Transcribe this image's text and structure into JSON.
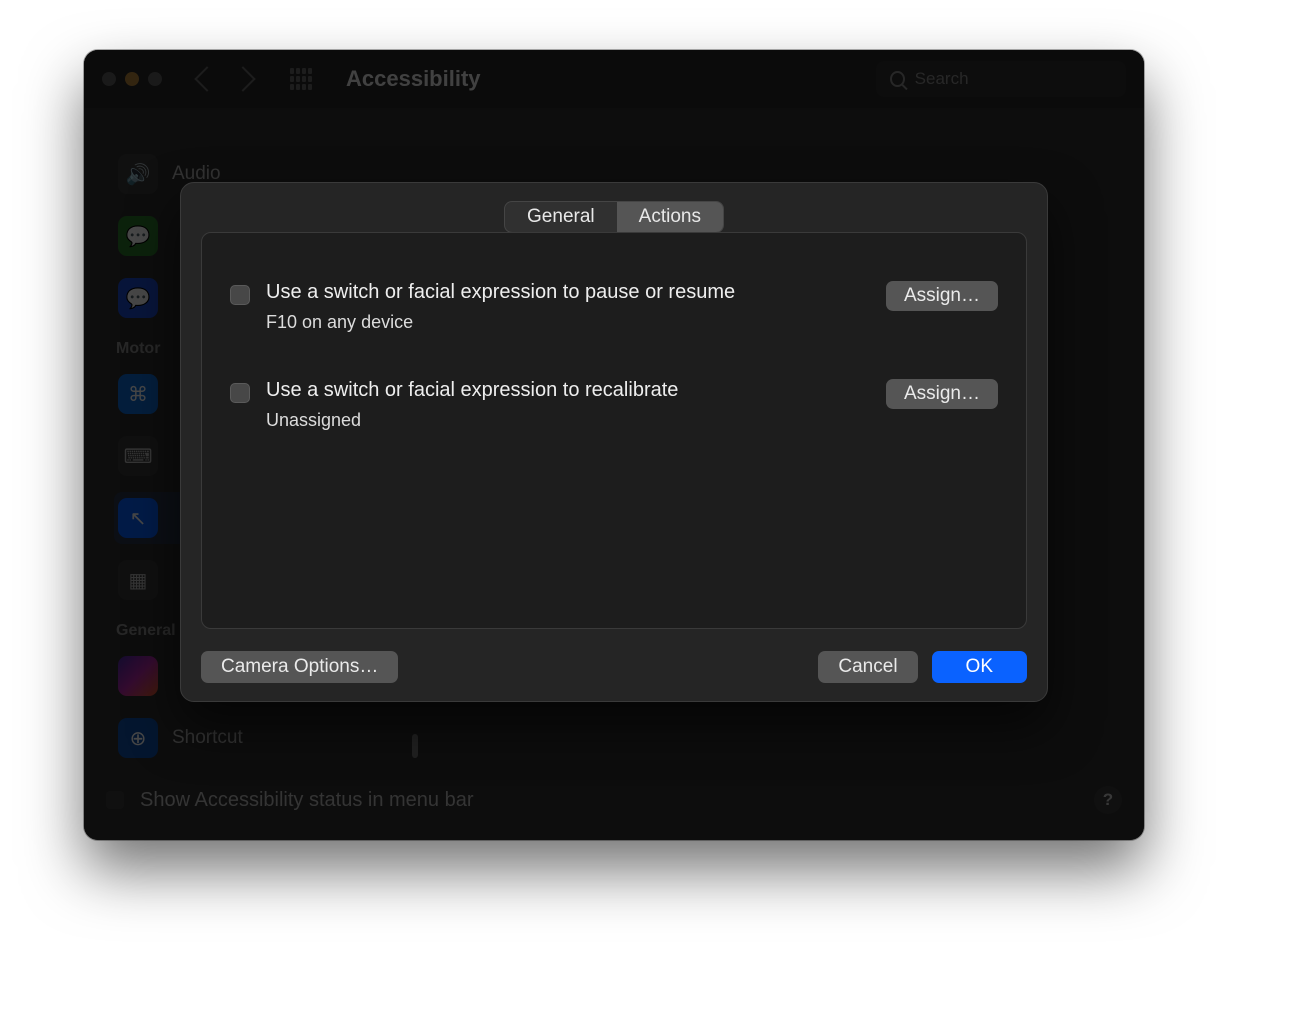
{
  "window": {
    "title": "Accessibility",
    "search_placeholder": "Search"
  },
  "sidebar": {
    "items": [
      {
        "label": "Audio"
      },
      {
        "label": ""
      },
      {
        "label": ""
      },
      {
        "section": "Motor"
      },
      {
        "label": ""
      },
      {
        "label": ""
      },
      {
        "label": ""
      },
      {
        "section": "General"
      },
      {
        "label": ""
      },
      {
        "label": "Shortcut"
      }
    ]
  },
  "footer": {
    "label": "Show Accessibility status in menu bar"
  },
  "sheet": {
    "tabs": {
      "general": "General",
      "actions": "Actions"
    },
    "active_tab": "actions",
    "options": [
      {
        "title": "Use a switch or facial expression to pause or resume",
        "subtitle": "F10 on any device",
        "assign_label": "Assign…",
        "checked": false
      },
      {
        "title": "Use a switch or facial expression to recalibrate",
        "subtitle": "Unassigned",
        "assign_label": "Assign…",
        "checked": false
      }
    ],
    "buttons": {
      "camera": "Camera Options…",
      "cancel": "Cancel",
      "ok": "OK"
    }
  },
  "help_label": "?"
}
